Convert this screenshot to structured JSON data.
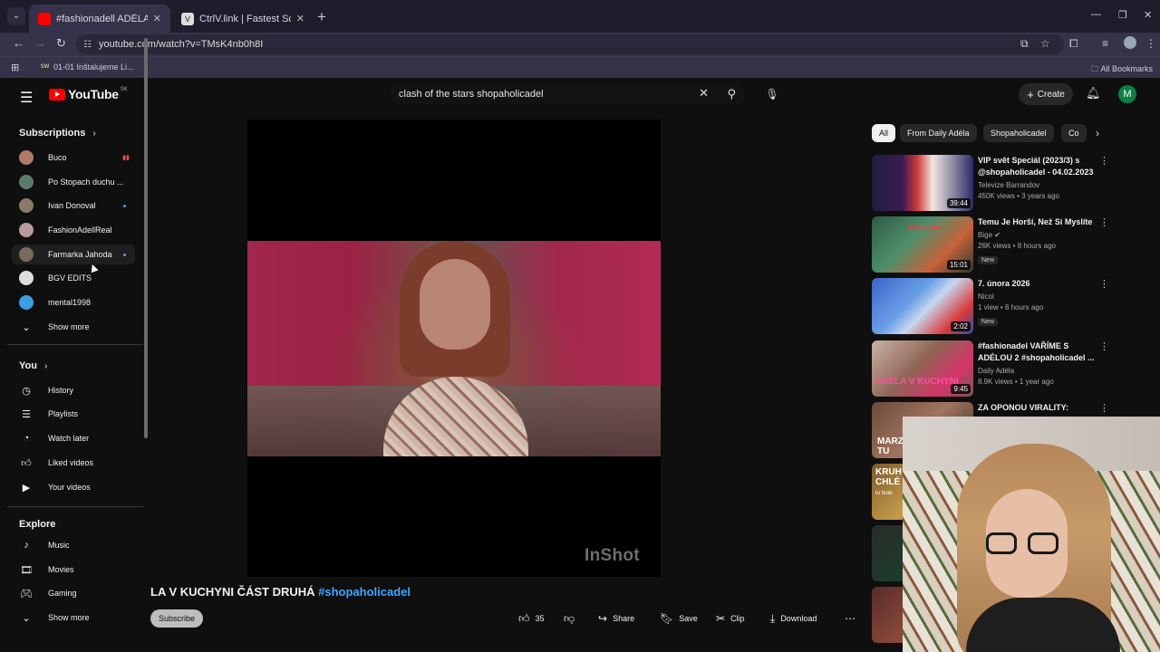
{
  "browser": {
    "tabs": [
      {
        "title": "#fashionadell ADÉLA V KUCHYNI",
        "active": true
      },
      {
        "title": "CtrlV.link | Fastest ScreenShot and Free Image Hosting",
        "active": false
      }
    ],
    "url": "youtube.com/watch?v=TMsK4nb0h8I",
    "bookmark": "01-01 Inštalujeme Li...",
    "bookmark_icon_text": "SW",
    "all_bookmarks": "All Bookmarks"
  },
  "header": {
    "logo": "YouTube",
    "country_code": "SK",
    "search_query": "clash of the stars shopaholicadel",
    "create_label": "Create",
    "avatar_letter": "M"
  },
  "sidebar": {
    "subscriptions_title": "Subscriptions",
    "subscriptions": [
      {
        "name": "Buco",
        "badge": "live"
      },
      {
        "name": "Po Stopach duchu ...",
        "badge": ""
      },
      {
        "name": "Ivan Donoval",
        "badge": "dot"
      },
      {
        "name": "FashionAdellReal",
        "badge": ""
      },
      {
        "name": "Farmarka Jahoda",
        "badge": "dot"
      },
      {
        "name": "BGV EDITS",
        "badge": ""
      },
      {
        "name": "mental1998",
        "badge": ""
      }
    ],
    "show_more": "Show more",
    "you_title": "You",
    "you_items": [
      "History",
      "Playlists",
      "Watch later",
      "Liked videos",
      "Your videos"
    ],
    "explore_title": "Explore",
    "explore_items": [
      "Music",
      "Movies",
      "Gaming"
    ],
    "explore_show_more": "Show more"
  },
  "player": {
    "watermark": "InShot",
    "title_main": "LA V KUCHYNI ČÁST DRUHÁ ",
    "title_tag": "#shopaholicadel"
  },
  "actions": {
    "subscribe": "Subscribe",
    "likes": "35",
    "share": "Share",
    "save": "Save",
    "clip": "Clip",
    "download": "Download"
  },
  "chips": [
    "All",
    "From Daily Adéla",
    "Shopaholicadel",
    "Co"
  ],
  "recommendations": [
    {
      "title": "VIP svět Speciál (2023/3) s @shopaholicadel - 04.02.2023",
      "channel": "Televize Barrandov",
      "views": "450K views • 3 years ago",
      "duration": "39:44",
      "badge": ""
    },
    {
      "title": "Temu Je Horší, Než Si Myslíte",
      "channel": "Bige",
      "views": "26K views • 8 hours ago",
      "duration": "15:01",
      "badge": "New",
      "thumb_text": "NELEGÁLNÍ"
    },
    {
      "title": "7. února 2026",
      "channel": "Nicol",
      "views": "1 view • 8 hours ago",
      "duration": "2:02",
      "badge": "New"
    },
    {
      "title": "#fashionadel VAŘÍME S ADÉLOU 2 #shopaholicadel ...",
      "channel": "Daily Adéla",
      "views": "8.9K views • 1 year ago",
      "duration": "9:45",
      "badge": "",
      "thumb_text": "ADÉLA V KUCHYNI"
    },
    {
      "title": "ZA OPONOU VIRALITY:",
      "channel": "",
      "views": "",
      "duration": "",
      "badge": "",
      "thumb_text": "MARZ TU"
    },
    {
      "title": "",
      "channel": "",
      "views": "",
      "duration": "",
      "badge": "",
      "thumb_text": "KRUH CHLÉ",
      "thumb_subtext": "tu hrab"
    }
  ],
  "colors": {
    "background": "#0f0f0f",
    "accent_red": "#ff0000",
    "link_blue": "#3ea6ff",
    "tab_active": "#35324a"
  }
}
